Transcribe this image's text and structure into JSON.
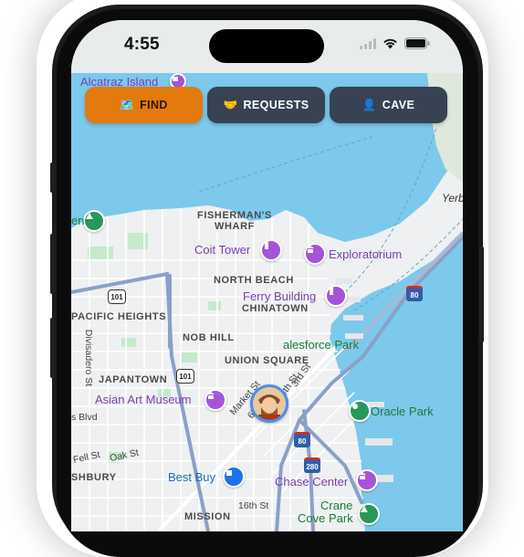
{
  "status_bar": {
    "time": "4:55",
    "icons": [
      "cellular-signal-icon",
      "wifi-icon",
      "battery-icon"
    ]
  },
  "tabs": [
    {
      "label": "FIND",
      "icon": "map-icon",
      "emoji": "🗺️",
      "color": "#e27a0e",
      "active": true
    },
    {
      "label": "REQUESTS",
      "icon": "handshake-icon",
      "emoji": "🤝",
      "color": "#374253",
      "active": false
    },
    {
      "label": "CAVE",
      "icon": "person-icon",
      "emoji": "👤",
      "color": "#374253",
      "active": false
    }
  ],
  "map": {
    "districts": [
      "FISHERMAN'S",
      "WHARF",
      "NORTH BEACH",
      "CHINATOWN",
      "PACIFIC HEIGHTS",
      "NOB HILL",
      "UNION SQUARE",
      "JAPANTOWN",
      "SHBURY",
      "MISSION"
    ],
    "pois": {
      "alcatraz": "Alcatraz Island",
      "coit_tower": "Coit Tower",
      "exploratorium": "Exploratorium",
      "ferry_building": "Ferry Building",
      "salesforce_park": "alesforce Park",
      "asian_art_museum": "Asian Art Museum",
      "oracle_park": "Oracle Park",
      "best_buy": "Best Buy",
      "chase_center": "Chase Center",
      "crane_cove_park_1": "Crane",
      "crane_cove_park_2": "Cove Park",
      "yerba": "Yerb",
      "en": "en"
    },
    "streets": [
      "Market St",
      "4th St",
      "3rd St",
      "6th St",
      "Divisadero St",
      "Oak St",
      "Fell St",
      "16th St",
      "s Blvd"
    ],
    "highway_shields": [
      "101",
      "101",
      "80",
      "80",
      "280"
    ],
    "user_avatar": "user-location-avatar"
  },
  "colors": {
    "water": "#7cc9ec",
    "land": "#eef0f1",
    "park": "#c6e9cc",
    "highway": "#8aa0c8",
    "find_tab": "#e27a0e",
    "other_tab": "#374253"
  }
}
